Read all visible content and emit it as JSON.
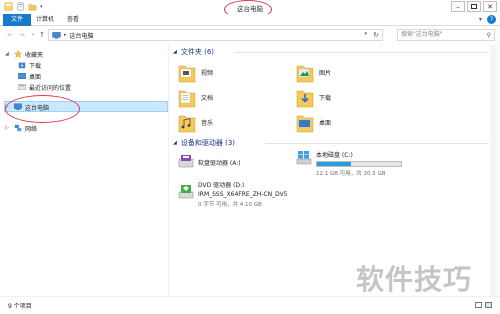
{
  "window": {
    "title": "这台电脑"
  },
  "ribbon": {
    "tabs": [
      {
        "label": "文件"
      },
      {
        "label": "计算机"
      },
      {
        "label": "查看"
      }
    ],
    "help": "?"
  },
  "address": {
    "crumb": "这台电脑",
    "search_placeholder": "搜索\"这台电脑\""
  },
  "navpane": {
    "favorites": "收藏夹",
    "downloads": "下载",
    "desktop": "桌面",
    "recent": "最近访问的位置",
    "this_pc": "这台电脑",
    "network": "网络"
  },
  "content": {
    "folders_header": "文件夹 (6)",
    "folders": [
      {
        "label": "视频"
      },
      {
        "label": "图片"
      },
      {
        "label": "文档"
      },
      {
        "label": "下载"
      },
      {
        "label": "音乐"
      },
      {
        "label": "桌面"
      }
    ],
    "devices_header": "设备和驱动器 (3)",
    "drives": [
      {
        "name": "软盘驱动器 (A:)"
      },
      {
        "name": "本地磁盘 (C:)",
        "info": "12.1 GB 可用，共 20.5 GB",
        "used_fraction": 0.41
      },
      {
        "name": "DVD 驱动器 (D:)",
        "name2": "IRM_SSS_X64FRE_ZH-CN_DV5",
        "info": "0 字节 可用，共 4.10 GB"
      }
    ]
  },
  "status": {
    "count": "9 个项目"
  },
  "watermark": "软件技巧",
  "colors": {
    "accent": "#1979ca",
    "selection": "#cce8ff",
    "annotation": "#e03a4b",
    "header": "#1e3287",
    "folder": "#f5c95a"
  }
}
